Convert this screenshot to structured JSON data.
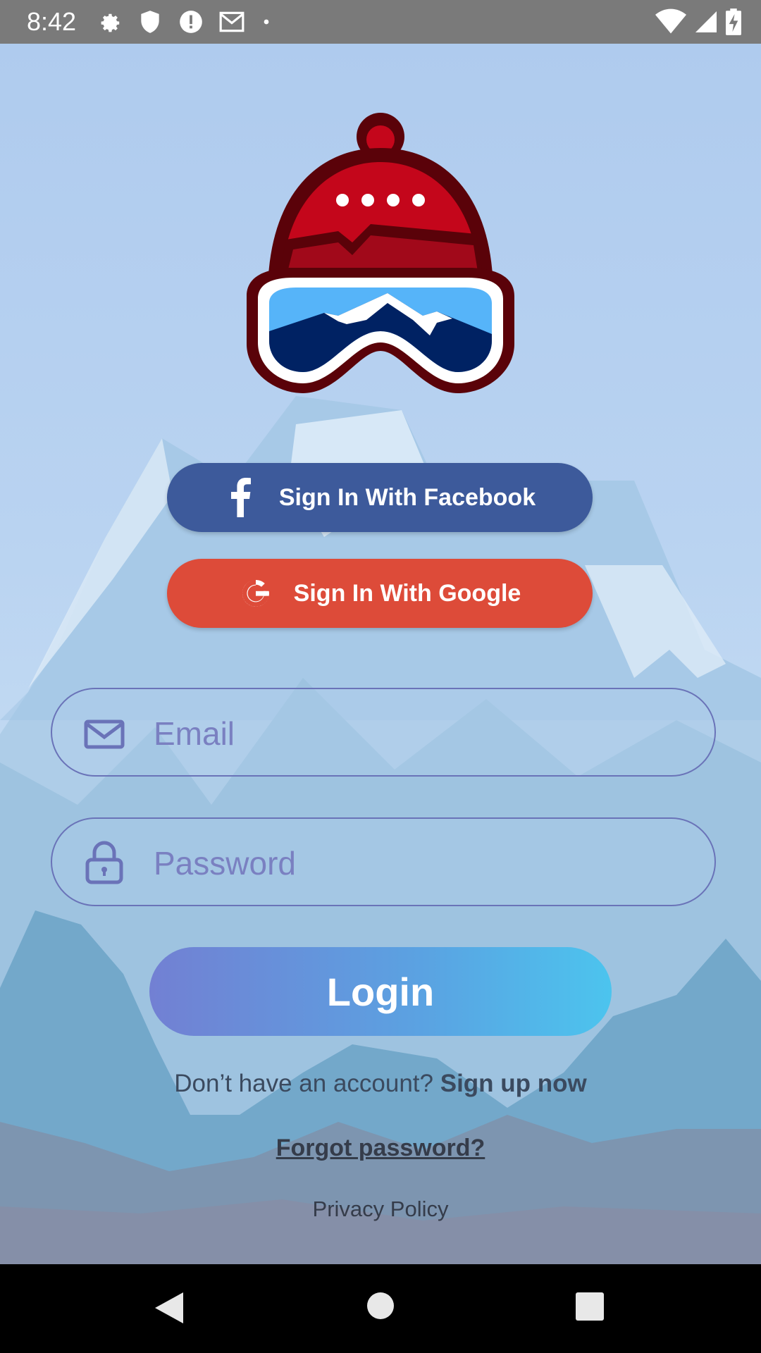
{
  "status_bar": {
    "time": "8:42",
    "left_icons": [
      "gear-icon",
      "shield-icon",
      "alert-icon",
      "gmail-icon",
      "dot-icon"
    ],
    "right_icons": [
      "wifi-icon",
      "signal-icon",
      "battery-charging-icon"
    ]
  },
  "logo": {
    "icon": "ski-beanie-goggles-logo",
    "colors": {
      "hat": "#c4061b",
      "outline": "#5a0209",
      "lens": "#56b4f9",
      "mountain": "#002263"
    }
  },
  "social": {
    "facebook": {
      "label": "Sign In With Facebook",
      "icon": "facebook-icon",
      "color": "#3d5a9b"
    },
    "google": {
      "label": "Sign In With Google",
      "icon": "google-icon",
      "color": "#dd4b39"
    }
  },
  "form": {
    "email": {
      "placeholder": "Email",
      "value": "",
      "icon": "mail-icon"
    },
    "password": {
      "placeholder": "Password",
      "value": "",
      "icon": "lock-icon"
    },
    "login_label": "Login"
  },
  "footer": {
    "signup_prompt": "Don’t have an account?",
    "signup_link": "Sign up now",
    "forgot_password": "Forgot password?",
    "privacy_policy": "Privacy Policy"
  },
  "nav_bar": {
    "icons": [
      "back-icon",
      "home-icon",
      "recents-icon"
    ]
  }
}
